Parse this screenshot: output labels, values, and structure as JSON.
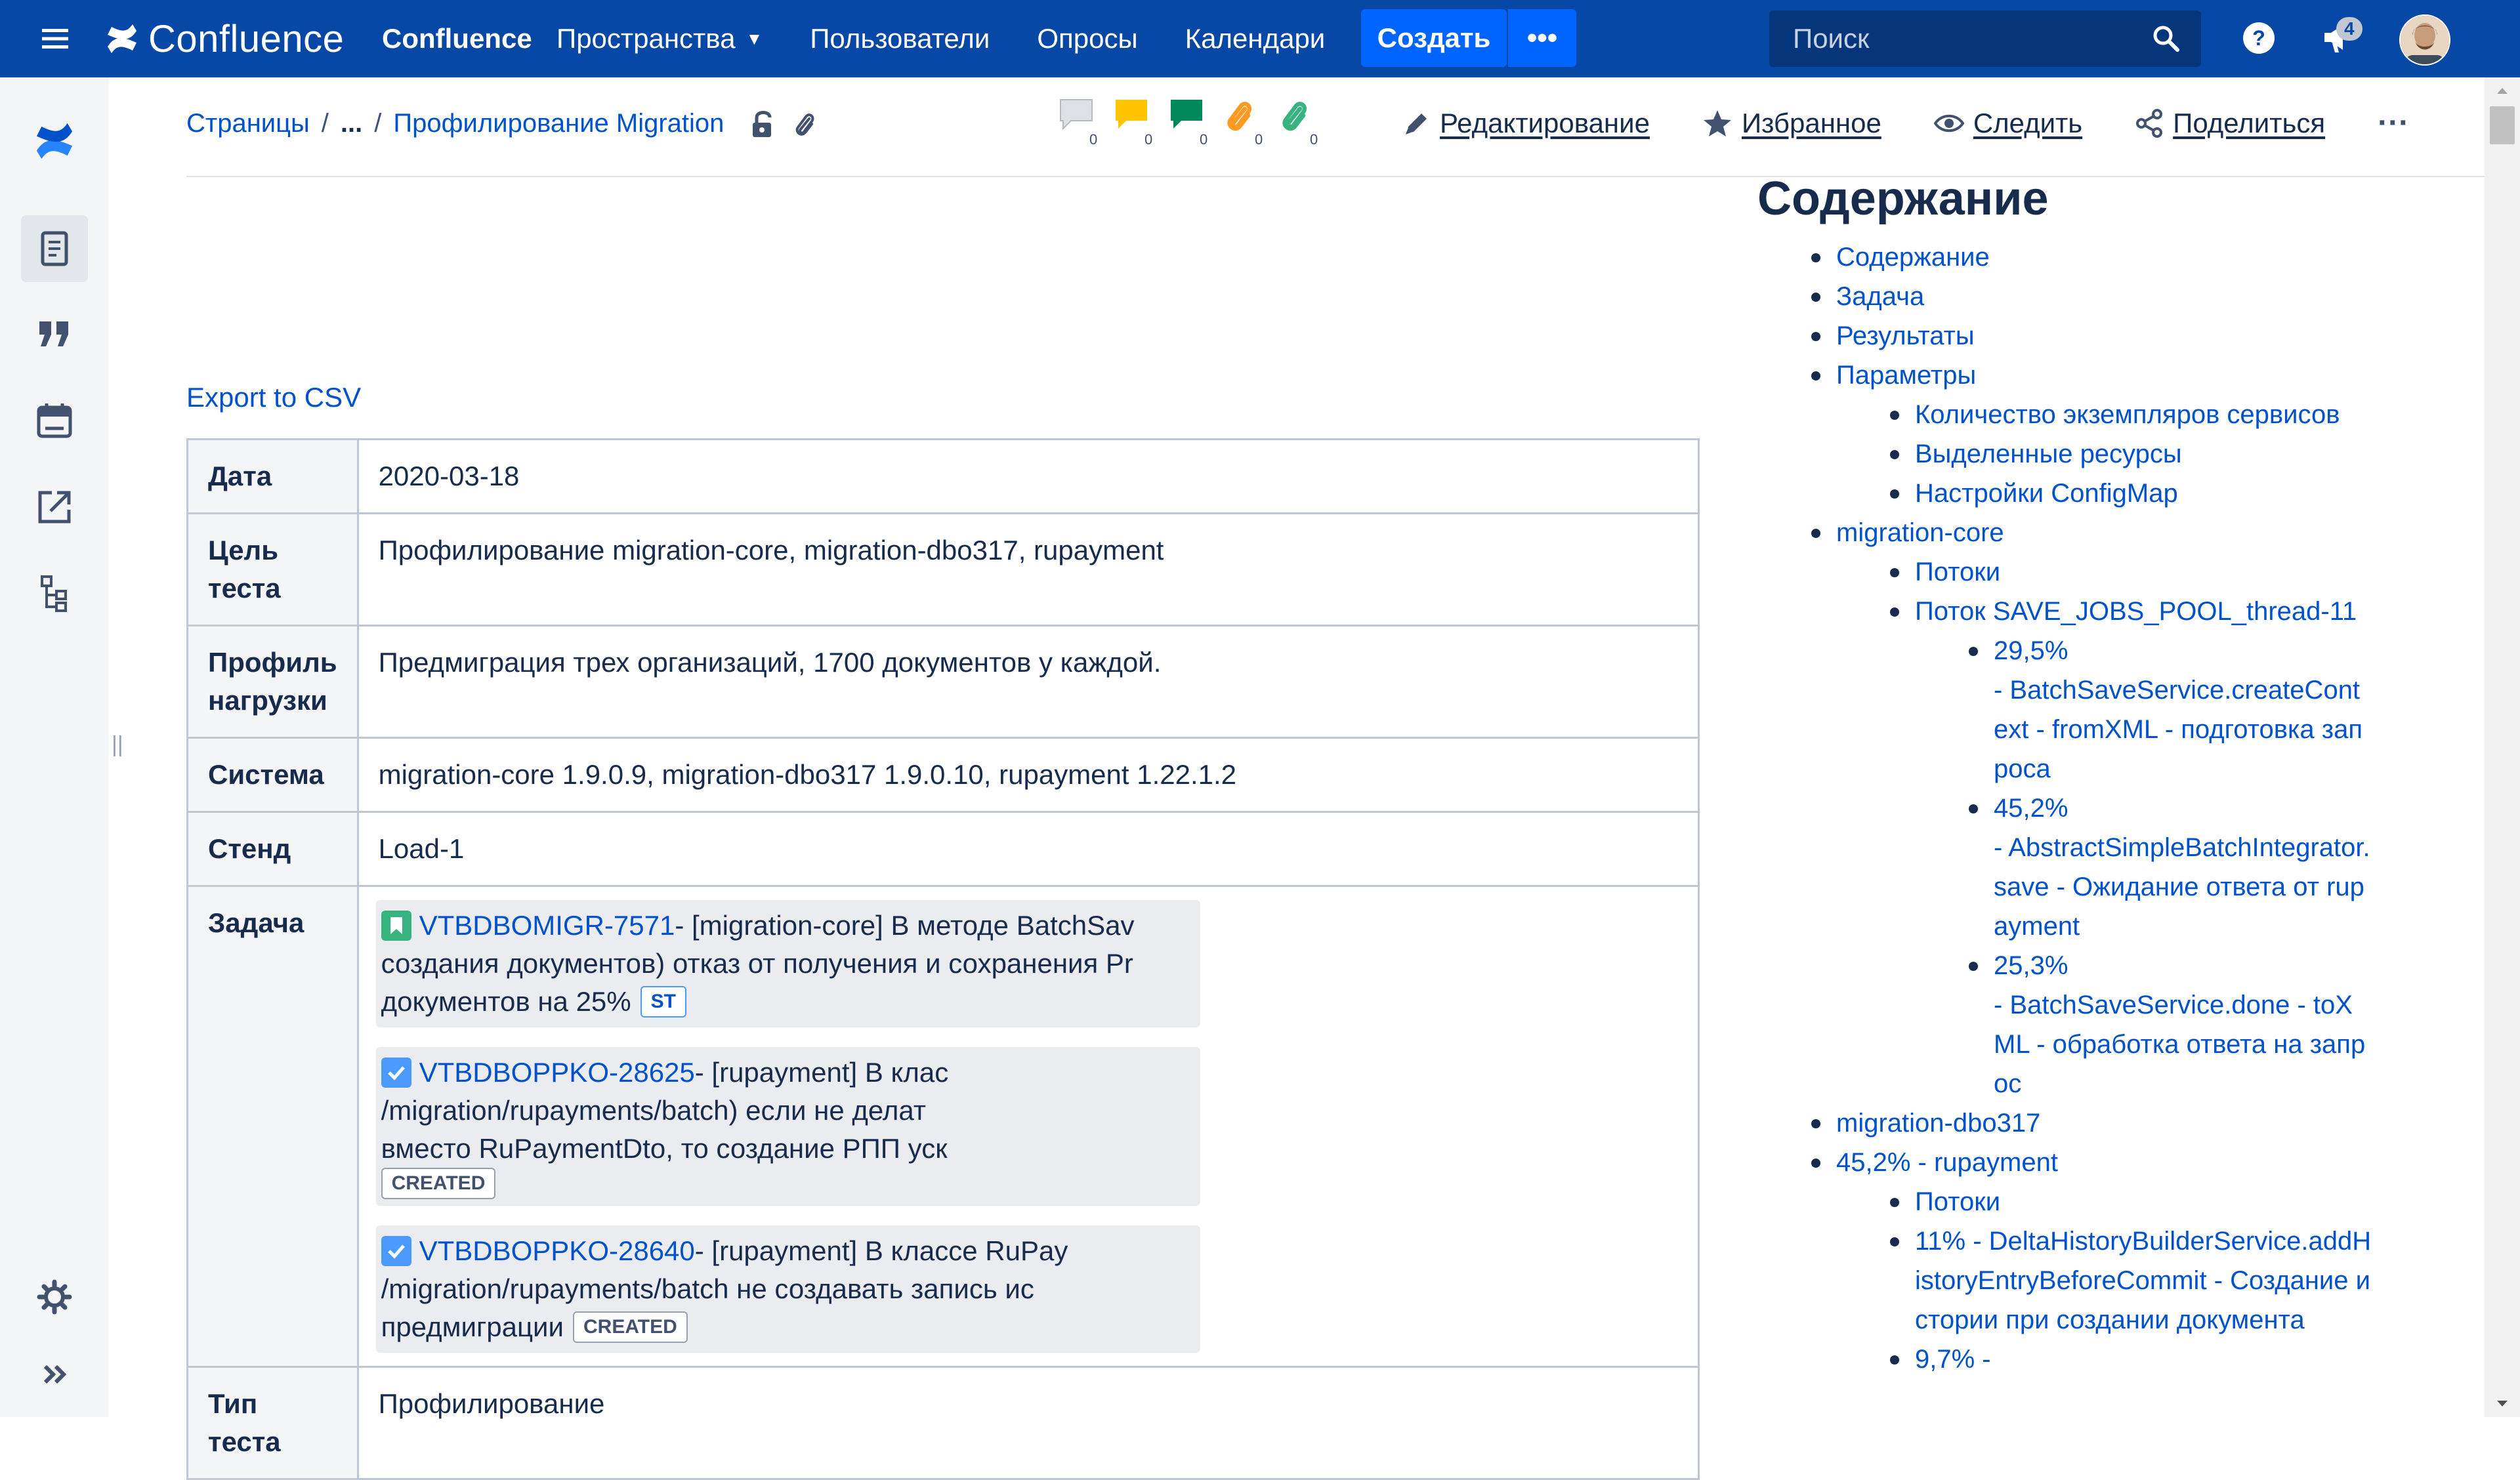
{
  "topnav": {
    "logo_text": "Confluence",
    "space_title": "Confluence",
    "links": [
      "Пространства",
      "Пользователи",
      "Опросы",
      "Календари"
    ],
    "create_label": "Создать",
    "more_label": "•••",
    "search_placeholder": "Поиск",
    "notification_count": "4",
    "colors": {
      "bar": "#0747a6",
      "create": "#0065ff"
    }
  },
  "sidebar": {
    "items": [
      "confluence-logo-icon",
      "pages-icon",
      "quote-icon",
      "calendar-icon",
      "external-link-icon",
      "tree-icon"
    ],
    "bottom": [
      "gear-icon",
      "expand-icon"
    ]
  },
  "breadcrumb": {
    "root": "Страницы",
    "ellipsis": "...",
    "current": "Профилирование Migration"
  },
  "reactions": [
    {
      "icon": "comment-grey-icon",
      "count": "0"
    },
    {
      "icon": "comment-yellow-icon",
      "count": "0"
    },
    {
      "icon": "comment-green-icon",
      "count": "0"
    },
    {
      "icon": "attachment-orange-icon",
      "count": "0"
    },
    {
      "icon": "attachment-green-icon",
      "count": "0"
    }
  ],
  "actions": {
    "edit": "Редактирование",
    "favorite": "Избранное",
    "watch": "Следить",
    "share": "Поделиться",
    "more": "···"
  },
  "content": {
    "export_csv": "Export to CSV",
    "table": {
      "date_key": "Дата",
      "date_val": "2020-03-18",
      "goal_key": "Цель теста",
      "goal_val": "Профилирование migration-core, migration-dbo317, rupayment",
      "load_key": "Профиль нагрузки",
      "load_val": "Предмиграция трех организаций, 1700 документов у каждой.",
      "system_key": "Система",
      "system_val": "migration-core 1.9.0.9, migration-dbo317 1.9.0.10, rupayment 1.22.1.2",
      "stand_key": "Стенд",
      "stand_val": "Load-1",
      "task_key": "Задача",
      "type_key": "Тип теста",
      "type_val": "Профилирование"
    },
    "tasks": [
      {
        "key": "VTBDBOMIGR-7571",
        "line1": " - [migration-core] В методе BatchSav",
        "line2": "создания документов) отказ от получения и сохранения Pr",
        "line3": "документов на 25%",
        "status": "ST"
      },
      {
        "key": "VTBDBOPPKO-28625",
        "line1": " - [rupayment] В клас",
        "line2": "/migration/rupayments/batch) если не делат",
        "line3": "вместо RuPaymentDto, то создание РПП уск",
        "status": "CREATED"
      },
      {
        "key": "VTBDBOPPKO-28640",
        "line1": " - [rupayment] В классе RuPay",
        "line2": "/migration/rupayments/batch не создавать запись ис",
        "line3": "предмиграции",
        "status": "CREATED"
      }
    ]
  },
  "toc": {
    "title": "Содержание",
    "items": [
      {
        "level": 1,
        "text": "Содержание"
      },
      {
        "level": 1,
        "text": "Задача"
      },
      {
        "level": 1,
        "text": "Результаты"
      },
      {
        "level": 1,
        "text": "Параметры"
      },
      {
        "level": 2,
        "text": "Количество экземпляров сервисов"
      },
      {
        "level": 2,
        "text": "Выделенные ресурсы"
      },
      {
        "level": 2,
        "text": "Настройки ConfigMap"
      },
      {
        "level": 1,
        "text": "migration-core"
      },
      {
        "level": 2,
        "text": "Потоки"
      },
      {
        "level": 2,
        "text": "Поток SAVE_JOBS_POOL_thread-11"
      },
      {
        "level": 3,
        "text": "29,5%"
      },
      {
        "level": 3,
        "text": " - BatchSaveService.createContext - fromXML - подготовка запроса"
      },
      {
        "level": 3,
        "text": "45,2%"
      },
      {
        "level": 3,
        "text": " - AbstractSimpleBatchIntegrator.save - Ожидание ответа от rupayment"
      },
      {
        "level": 3,
        "text": "25,3%"
      },
      {
        "level": 3,
        "text": " - BatchSaveService.done - toXML - обработка ответа на запрос"
      },
      {
        "level": 1,
        "text": "migration-dbo317"
      },
      {
        "level": 1,
        "text": "45,2% - rupayment"
      },
      {
        "level": 2,
        "text": "Потоки"
      },
      {
        "level": 2,
        "text": "11% - DeltaHistoryBuilderService.addHistoryEntryBeforeCommit - Создание истории при создании документа"
      },
      {
        "level": 2,
        "text": "9,7% -"
      }
    ]
  }
}
